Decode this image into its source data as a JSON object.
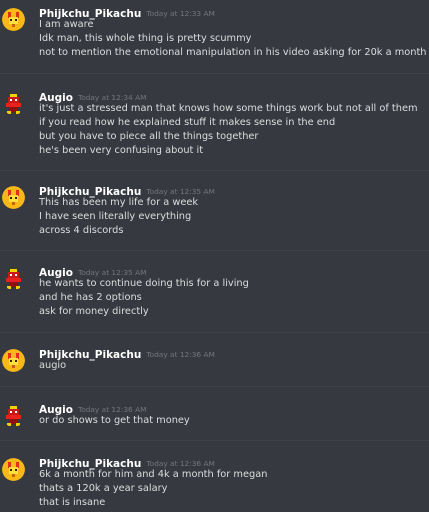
{
  "messages": [
    {
      "username": "Phijkchu_Pikachu",
      "timestamp": "Today at 12:33 AM",
      "avatar_icon": "pikachu-avatar-icon",
      "lines": [
        "I am aware",
        "Idk man, this whole thing is pretty scummy",
        "not to mention the emotional manipulation in his video asking for 20k a month"
      ]
    },
    {
      "username": "Augio",
      "timestamp": "Today at 12:34 AM",
      "avatar_icon": "red-character-avatar-icon",
      "lines": [
        "it's just a stressed man that knows how some things work but not all of them",
        "if you read how he explained stuff it makes sense in the end",
        "but you have to piece all the things together",
        "he's been very confusing about it"
      ]
    },
    {
      "username": "Phijkchu_Pikachu",
      "timestamp": "Today at 12:35 AM",
      "avatar_icon": "pikachu-avatar-icon",
      "lines": [
        "This has been my life for a week",
        "I have seen literally everything",
        "across 4 discords"
      ]
    },
    {
      "username": "Augio",
      "timestamp": "Today at 12:35 AM",
      "avatar_icon": "red-character-avatar-icon",
      "lines": [
        "he wants to continue doing this for a living",
        "and he has 2 options",
        "ask for money directly"
      ]
    },
    {
      "username": "Phijkchu_Pikachu",
      "timestamp": "Today at 12:36 AM",
      "avatar_icon": "pikachu-avatar-icon",
      "lines": [
        "augio"
      ]
    },
    {
      "username": "Augio",
      "timestamp": "Today at 12:36 AM",
      "avatar_icon": "red-character-avatar-icon",
      "lines": [
        "or do shows to get that money"
      ]
    },
    {
      "username": "Phijkchu_Pikachu",
      "timestamp": "Today at 12:36 AM",
      "avatar_icon": "pikachu-avatar-icon",
      "lines": [
        "6k a month for him and 4k a month for megan",
        "thats a 120k a year salary",
        "that is insane"
      ]
    }
  ],
  "colors": {
    "background": "#36393f",
    "username": "#ffffff",
    "timestamp": "#72767d",
    "message_text": "#dcddde",
    "divider": "#3e4147"
  }
}
